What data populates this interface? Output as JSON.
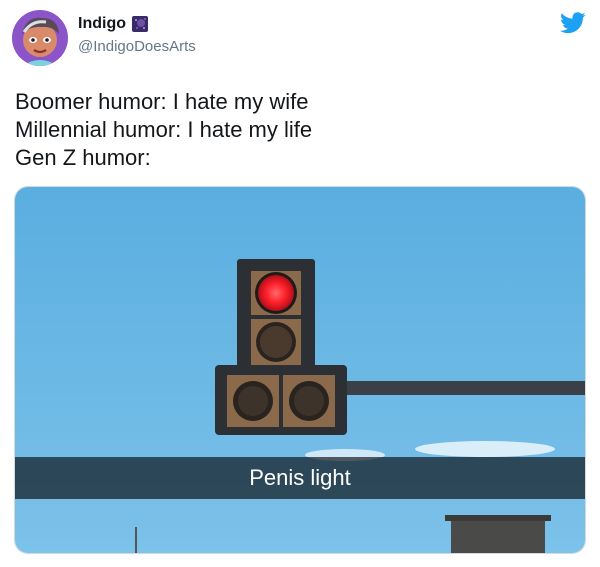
{
  "tweet": {
    "author": {
      "display_name": "Indigo",
      "handle": "@IndigoDoesArts",
      "badge_icon": "galaxy-emoji-icon",
      "avatar_icon": "illustrated-avatar"
    },
    "brand_icon": "twitter-bird-icon",
    "brand_color": "#1da1f2",
    "text_lines": [
      "Boomer humor: I hate my wife",
      "Millennial humor: I hate my life",
      "Gen Z humor:"
    ],
    "media": {
      "caption": "Penis light",
      "sky_color": "#5fb3e2",
      "light_color": "#ff1f2a"
    }
  }
}
